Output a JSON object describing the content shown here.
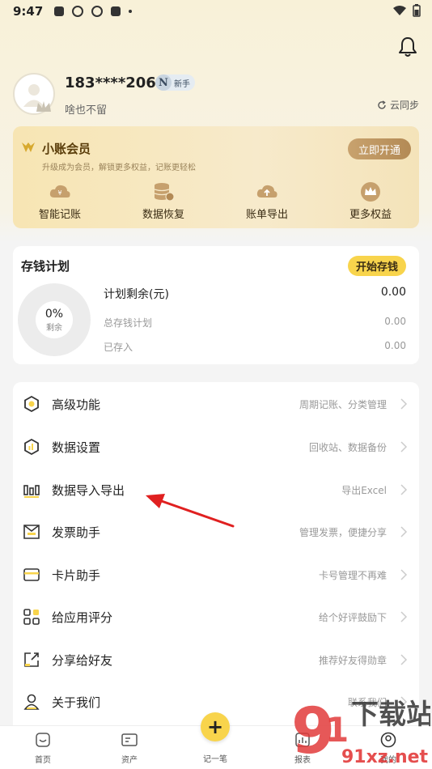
{
  "status_bar": {
    "time": "9:47"
  },
  "profile": {
    "username": "183****2063",
    "badge_letter": "N",
    "badge_label": "新手",
    "signature": "啥也不留",
    "sync_label": "云同步"
  },
  "vip": {
    "title": "小账会员",
    "subtitle": "升级成为会员，解锁更多权益，记账更轻松",
    "cta": "立即开通",
    "features": [
      {
        "label": "智能记账",
        "icon": "yen-cloud-icon"
      },
      {
        "label": "数据恢复",
        "icon": "database-icon"
      },
      {
        "label": "账单导出",
        "icon": "upload-cloud-icon"
      },
      {
        "label": "更多权益",
        "icon": "crown-icon"
      }
    ]
  },
  "savings_plan": {
    "title": "存钱计划",
    "start_button": "开始存钱",
    "progress_percent": "0%",
    "progress_label": "剩余",
    "remaining_label": "计划剩余(元)",
    "remaining_value": "0.00",
    "total_label": "总存钱计划",
    "total_value": "0.00",
    "saved_label": "已存入",
    "saved_value": "0.00"
  },
  "menu": [
    {
      "label": "高级功能",
      "hint": "周期记账、分类管理",
      "icon": "hexagon-icon"
    },
    {
      "label": "数据设置",
      "hint": "回收站、数据备份",
      "icon": "data-settings-icon"
    },
    {
      "label": "数据导入导出",
      "hint": "导出Excel",
      "icon": "bar-chart-icon"
    },
    {
      "label": "发票助手",
      "hint": "管理发票，便捷分享",
      "icon": "invoice-icon"
    },
    {
      "label": "卡片助手",
      "hint": "卡号管理不再难",
      "icon": "card-icon"
    },
    {
      "label": "给应用评分",
      "hint": "给个好评鼓励下",
      "icon": "grid-icon"
    },
    {
      "label": "分享给好友",
      "hint": "推荐好友得勋章",
      "icon": "share-icon"
    },
    {
      "label": "关于我们",
      "hint": "联系我们",
      "icon": "user-icon"
    }
  ],
  "tabbar": {
    "home": "首页",
    "assets": "资产",
    "add": "记一笔",
    "reports": "报表",
    "mine": "我的"
  },
  "watermark": {
    "brand": "下载站",
    "domain": "91xz.net"
  },
  "colors": {
    "accent_yellow": "#f8d44c",
    "gold": "#b38a55",
    "annotation_red": "#e02020"
  }
}
